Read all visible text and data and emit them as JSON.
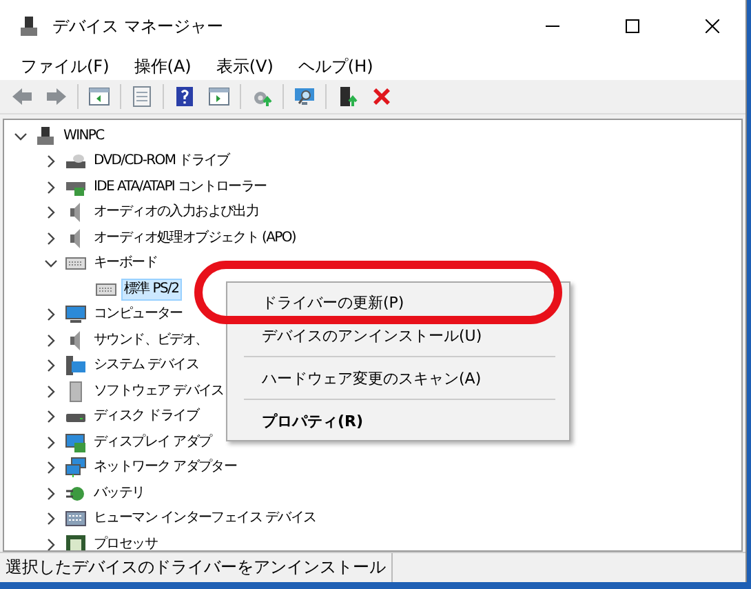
{
  "window": {
    "title": "デバイス マネージャー"
  },
  "menu_bar": [
    "ファイル(F)",
    "操作(A)",
    "表示(V)",
    "ヘルプ(H)"
  ],
  "toolbar": [
    {
      "kind": "back"
    },
    {
      "kind": "forward"
    },
    {
      "kind": "separator"
    },
    {
      "kind": "panel"
    },
    {
      "kind": "separator"
    },
    {
      "kind": "sheet"
    },
    {
      "kind": "separator"
    },
    {
      "kind": "help"
    },
    {
      "kind": "panel2"
    },
    {
      "kind": "separator"
    },
    {
      "kind": "update"
    },
    {
      "kind": "separator"
    },
    {
      "kind": "scan"
    },
    {
      "kind": "separator"
    },
    {
      "kind": "enable"
    },
    {
      "kind": "remove"
    }
  ],
  "tree": {
    "label": "WINPC",
    "kind": "computer",
    "expanded": true,
    "selected": false,
    "children": [
      {
        "label": "DVD/CD-ROM ドライブ",
        "kind": "dvd",
        "expanded": false,
        "selected": false
      },
      {
        "label": "IDE ATA/ATAPI コントローラー",
        "kind": "ide",
        "expanded": false,
        "selected": false
      },
      {
        "label": "オーディオの入力および出力",
        "kind": "audio",
        "expanded": false,
        "selected": false
      },
      {
        "label": "オーディオ処理オブジェクト (APO)",
        "kind": "audio",
        "expanded": false,
        "selected": false
      },
      {
        "label": "キーボード",
        "kind": "keyboard",
        "expanded": true,
        "selected": false,
        "children": [
          {
            "label": "標準 PS/2",
            "kind": "keyboard",
            "selected": true
          }
        ]
      },
      {
        "label": "コンピューター",
        "kind": "monitor",
        "expanded": false,
        "selected": false
      },
      {
        "label": "サウンド、ビデオ、",
        "kind": "audio",
        "expanded": false,
        "selected": false
      },
      {
        "label": "システム デバイス",
        "kind": "system",
        "expanded": false,
        "selected": false
      },
      {
        "label": "ソフトウェア デバイス",
        "kind": "software",
        "expanded": false,
        "selected": false
      },
      {
        "label": "ディスク ドライブ",
        "kind": "disk",
        "expanded": false,
        "selected": false
      },
      {
        "label": "ディスプレイ アダプ",
        "kind": "display",
        "expanded": false,
        "selected": false
      },
      {
        "label": "ネットワーク アダプター",
        "kind": "network",
        "expanded": false,
        "selected": false
      },
      {
        "label": "バッテリ",
        "kind": "battery",
        "expanded": false,
        "selected": false
      },
      {
        "label": "ヒューマン インターフェイス デバイス",
        "kind": "hid",
        "expanded": false,
        "selected": false
      },
      {
        "label": "プロセッサ",
        "kind": "processor",
        "expanded": false,
        "selected": false
      }
    ]
  },
  "context_menu": [
    {
      "kind": "item",
      "label": "ドライバーの更新(P)",
      "default": false,
      "circled": true
    },
    {
      "kind": "item",
      "label": "デバイスのアンインストール(U)",
      "default": false,
      "circled": false
    },
    {
      "kind": "separator"
    },
    {
      "kind": "item",
      "label": "ハードウェア変更のスキャン(A)",
      "default": false,
      "circled": false
    },
    {
      "kind": "separator"
    },
    {
      "kind": "item",
      "label": "プロパティ(R)",
      "default": true,
      "circled": false
    }
  ],
  "status_bar": "選択したデバイスのドライバーをアンインストール"
}
